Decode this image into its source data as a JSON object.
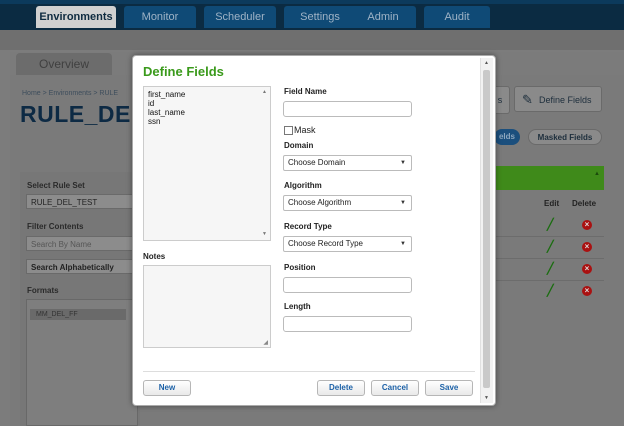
{
  "nav": {
    "tabs": [
      {
        "label": "Environments"
      },
      {
        "label": "Monitor"
      },
      {
        "label": "Scheduler"
      },
      {
        "label": "Settings"
      },
      {
        "label": "Admin"
      },
      {
        "label": "Audit"
      }
    ]
  },
  "page": {
    "overview_tab": "Overview",
    "breadcrumb": "Home > Environments > RULE",
    "title": "RULE_DE"
  },
  "toolbar": {
    "partial_button": "s",
    "define_fields_button": "Define Fields",
    "fields_pill": "elds",
    "masked_fields_pill": "Masked Fields"
  },
  "sidebar": {
    "select_rule_set_label": "Select Rule Set",
    "rule_set_value": "RULE_DEL_TEST",
    "filter_contents_label": "Filter Contents",
    "search_placeholder": "Search By Name",
    "sort_value": "Search Alphabetically",
    "formats_label": "Formats",
    "format_item": "MM_DEL_FF"
  },
  "table": {
    "edit_header": "Edit",
    "delete_header": "Delete",
    "sort_caret": "▲",
    "row_marker": "≡"
  },
  "modal": {
    "title": "Define Fields",
    "fields": [
      "first_name",
      "id",
      "last_name",
      "ssn"
    ],
    "notes_label": "Notes",
    "field_name_label": "Field Name",
    "mask_label": "Mask",
    "domain_label": "Domain",
    "domain_value": "Choose Domain",
    "algorithm_label": "Algorithm",
    "algorithm_value": "Choose Algorithm",
    "record_type_label": "Record Type",
    "record_type_value": "Choose Record Type",
    "position_label": "Position",
    "length_label": "Length",
    "new_button": "New",
    "delete_button": "Delete",
    "cancel_button": "Cancel",
    "save_button": "Save"
  },
  "colors": {
    "modal_title": "#3a9a1b",
    "button_text": "#1d62a8",
    "topbar": "#0b2b42"
  }
}
